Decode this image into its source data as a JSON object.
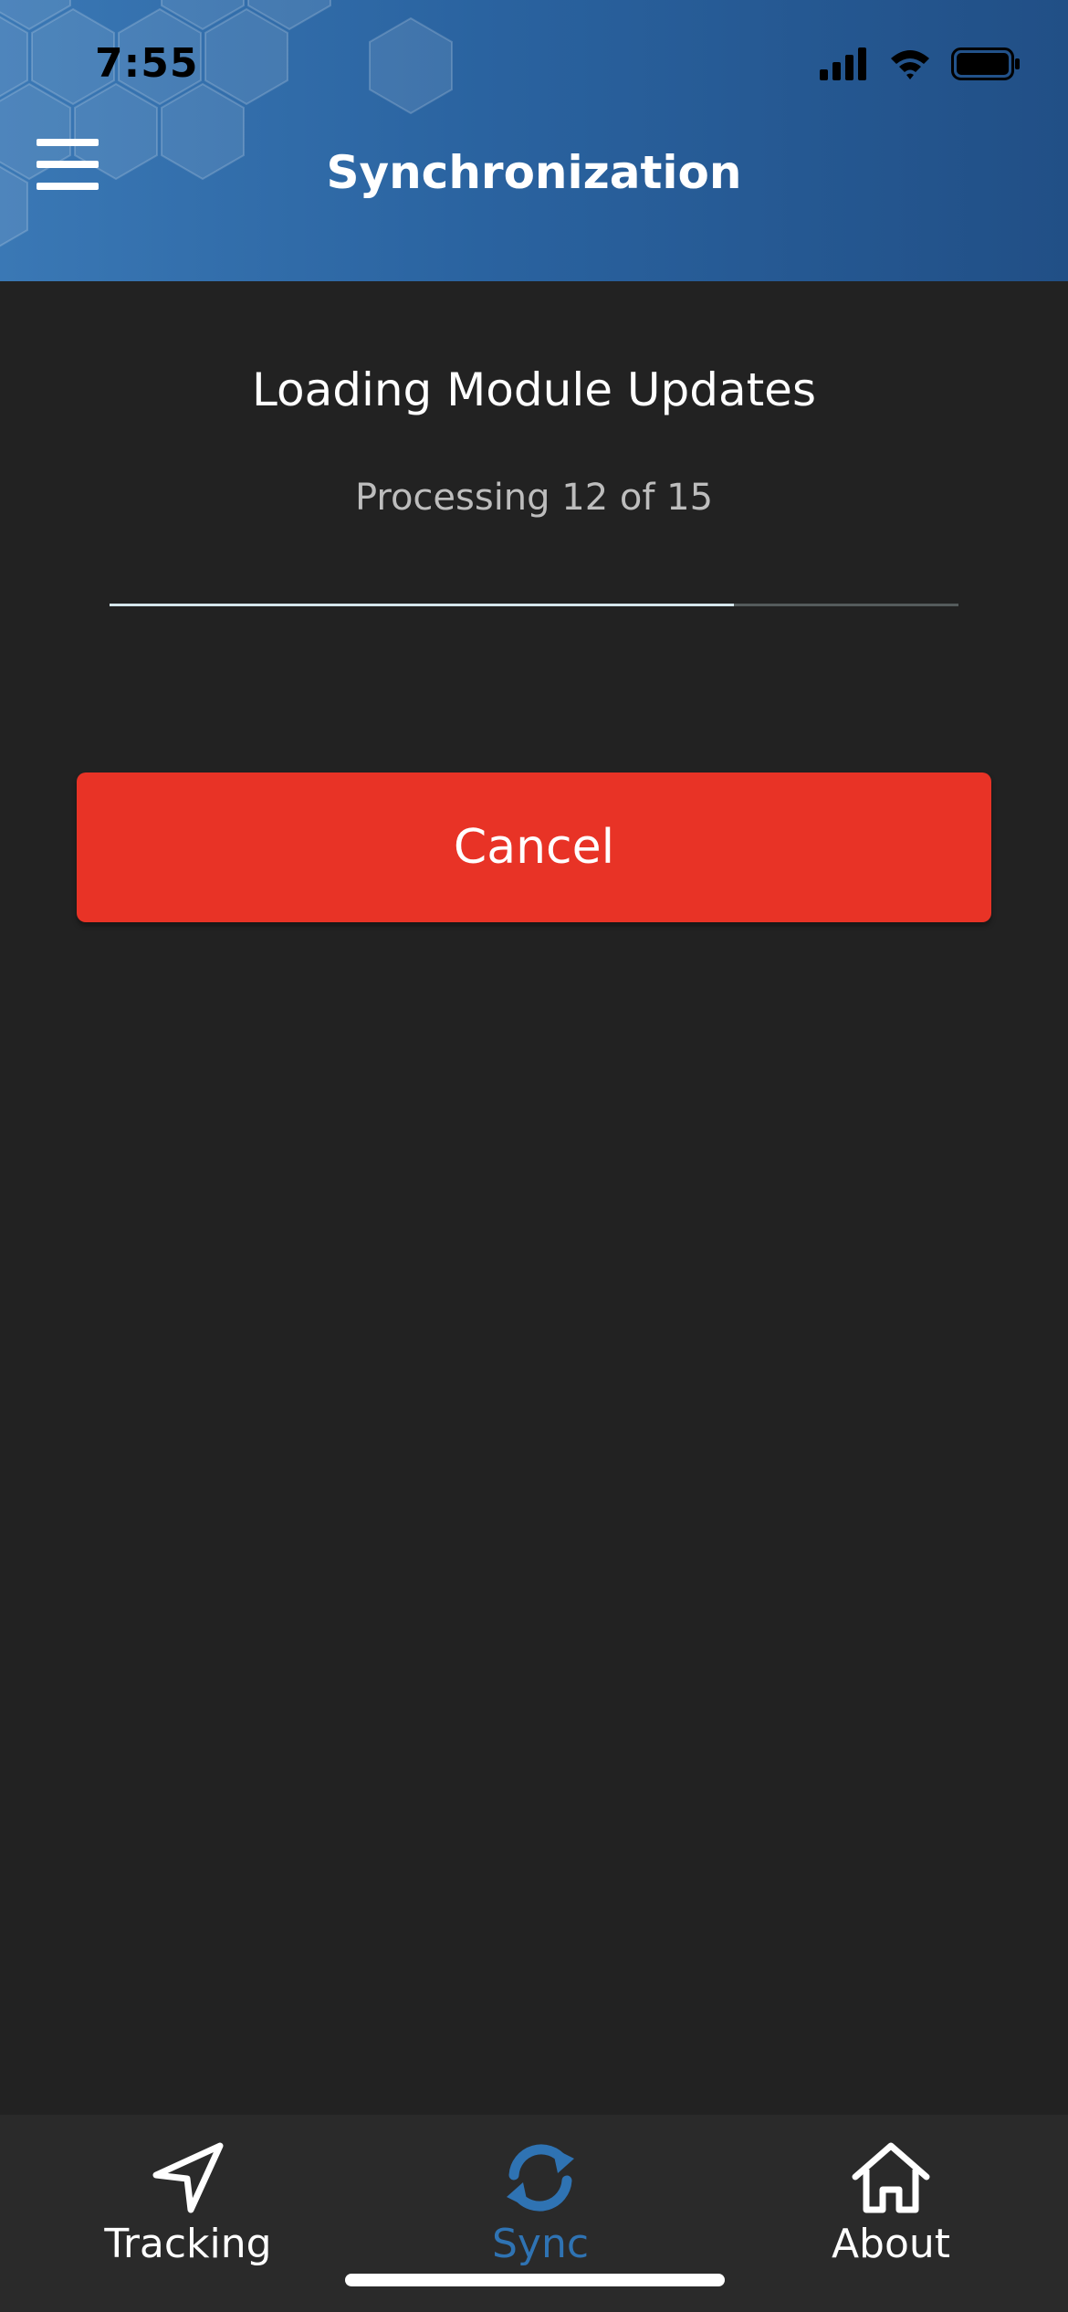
{
  "status_bar": {
    "time": "7:55",
    "icons": [
      "cellular-signal-icon",
      "wifi-icon",
      "battery-icon"
    ]
  },
  "header": {
    "title": "Synchronization",
    "menu_icon": "hamburger-menu-icon"
  },
  "content": {
    "loading_title": "Loading Module Updates",
    "progress_text": "Processing 12 of 15",
    "progress": {
      "current": 12,
      "total": 15,
      "fraction": 0.735
    },
    "cancel_label": "Cancel"
  },
  "tab_bar": {
    "tabs": [
      {
        "label": "Tracking",
        "icon": "navigation-arrow-icon",
        "active": false
      },
      {
        "label": "Sync",
        "icon": "sync-icon",
        "active": true
      },
      {
        "label": "About",
        "icon": "home-icon",
        "active": false
      }
    ]
  },
  "colors": {
    "header_gradient_start": "#3a78b5",
    "header_gradient_end": "#214f86",
    "background": "#222222",
    "cancel_button": "#e83326",
    "active_tab": "#2f73b3",
    "progress_fill": "#d5e6ec"
  }
}
